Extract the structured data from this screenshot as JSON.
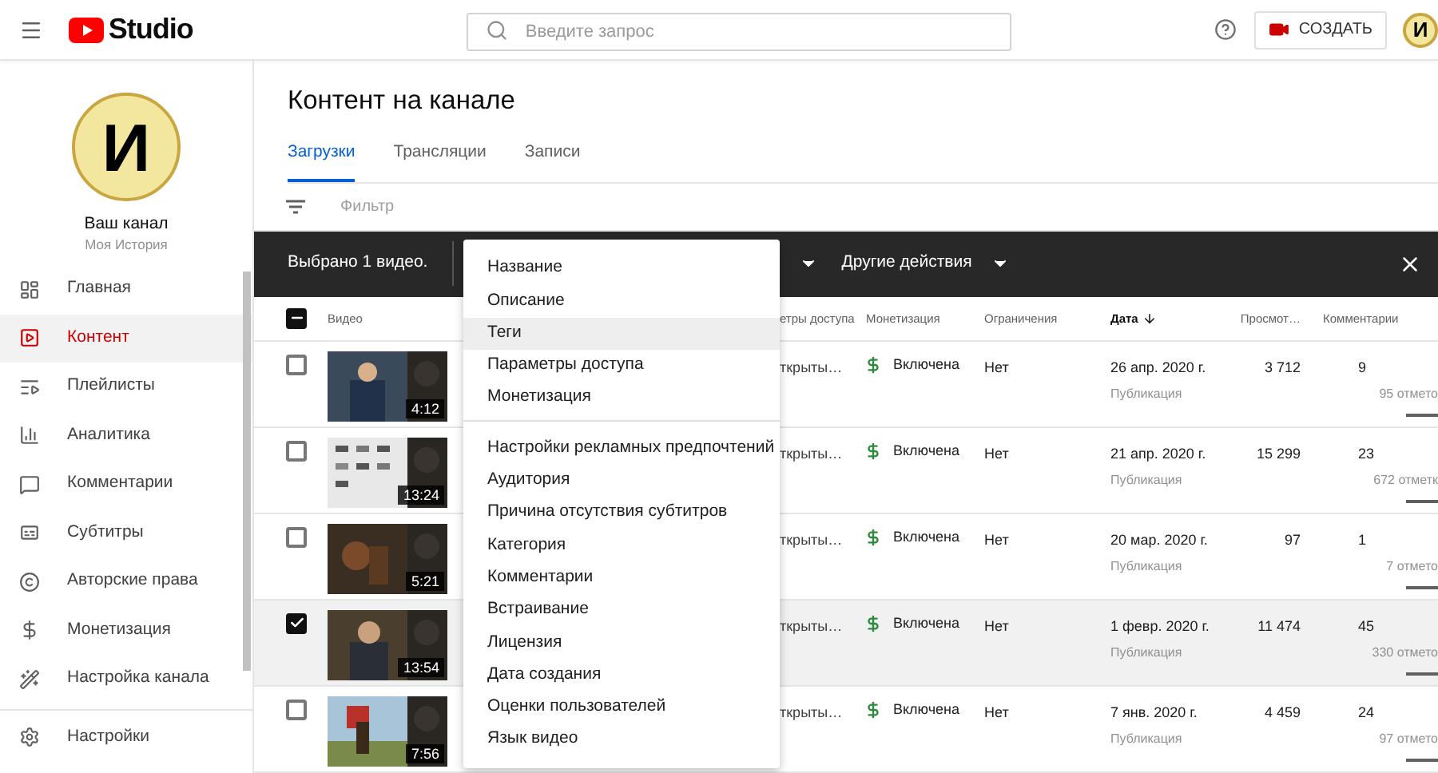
{
  "header": {
    "logo_text": "Studio",
    "search": {
      "placeholder": "Введите запрос"
    },
    "create_button": "СОЗДАТЬ",
    "avatar_letter": "И"
  },
  "sidebar": {
    "channel_logo_letter": "И",
    "channel_title": "Ваш канал",
    "channel_name": "Моя История",
    "items": [
      {
        "label": "Главная",
        "selected": false
      },
      {
        "label": "Контент",
        "selected": true
      },
      {
        "label": "Плейлисты",
        "selected": false
      },
      {
        "label": "Аналитика",
        "selected": false
      },
      {
        "label": "Комментарии",
        "selected": false
      },
      {
        "label": "Субтитры",
        "selected": false
      },
      {
        "label": "Авторские права",
        "selected": false
      },
      {
        "label": "Монетизация",
        "selected": false
      },
      {
        "label": "Настройка канала",
        "selected": false
      }
    ],
    "settings": "Настройки"
  },
  "page_title": "Контент на канале",
  "tabs": [
    {
      "label": "Загрузки",
      "selected": true
    },
    {
      "label": "Трансляции",
      "selected": false
    },
    {
      "label": "Записи",
      "selected": false
    }
  ],
  "filter": {
    "placeholder": "Фильтр"
  },
  "selection_bar": {
    "text": "Выбрано 1 видео.",
    "other_actions": "Другие действия"
  },
  "edit_menu": {
    "groups": [
      [
        {
          "label": "Название",
          "highlighted": false
        },
        {
          "label": "Описание",
          "highlighted": false
        },
        {
          "label": "Теги",
          "highlighted": true
        },
        {
          "label": "Параметры доступа",
          "highlighted": false
        },
        {
          "label": "Монетизация",
          "highlighted": false
        }
      ],
      [
        {
          "label": "Настройки рекламных предпочтений",
          "highlighted": false
        },
        {
          "label": "Аудитория",
          "highlighted": false
        },
        {
          "label": "Причина отсутствия субтитров",
          "highlighted": false
        },
        {
          "label": "Категория",
          "highlighted": false
        },
        {
          "label": "Комментарии",
          "highlighted": false
        },
        {
          "label": "Встраивание",
          "highlighted": false
        },
        {
          "label": "Лицензия",
          "highlighted": false
        },
        {
          "label": "Дата создания",
          "highlighted": false
        },
        {
          "label": "Оценки пользователей",
          "highlighted": false
        },
        {
          "label": "Язык видео",
          "highlighted": false
        }
      ]
    ]
  },
  "table": {
    "select_all_partial": true,
    "columns": [
      {
        "label": "Видео",
        "sorted": false
      },
      {
        "label": "етры доступа",
        "sorted": false
      },
      {
        "label": "Монетизация",
        "sorted": false
      },
      {
        "label": "Ограничения",
        "sorted": false
      },
      {
        "label": "Дата",
        "sorted": true
      },
      {
        "label": "Просмот…",
        "sorted": false
      },
      {
        "label": "Комментарии",
        "sorted": false
      }
    ],
    "rows": [
      {
        "checked": false,
        "duration": "4:12",
        "visibility": "ткрыты…",
        "monetization": "Включена",
        "restrictions": "Нет",
        "date": "26 апр. 2020 г.",
        "date_note": "Публикация",
        "views": "3 712",
        "comments": "9",
        "likes": "95 отмето"
      },
      {
        "checked": false,
        "duration": "13:24",
        "visibility": "ткрыты…",
        "monetization": "Включена",
        "restrictions": "Нет",
        "date": "21 апр. 2020 г.",
        "date_note": "Публикация",
        "views": "15 299",
        "comments": "23",
        "likes": "672 отметк"
      },
      {
        "checked": false,
        "duration": "5:21",
        "visibility": "ткрыты…",
        "monetization": "Включена",
        "restrictions": "Нет",
        "date": "20 мар. 2020 г.",
        "date_note": "Публикация",
        "views": "97",
        "comments": "1",
        "likes": "7 отмето"
      },
      {
        "checked": true,
        "duration": "13:54",
        "visibility": "ткрыты…",
        "monetization": "Включена",
        "restrictions": "Нет",
        "date": "1 февр. 2020 г.",
        "date_note": "Публикация",
        "views": "11 474",
        "comments": "45",
        "likes": "330 отмето"
      },
      {
        "checked": false,
        "duration": "7:56",
        "visibility": "ткрыты…",
        "monetization": "Включена",
        "restrictions": "Нет",
        "date": "7 янв. 2020 г.",
        "date_note": "Публикация",
        "views": "4 459",
        "comments": "24",
        "likes": "97 отмето"
      }
    ]
  }
}
